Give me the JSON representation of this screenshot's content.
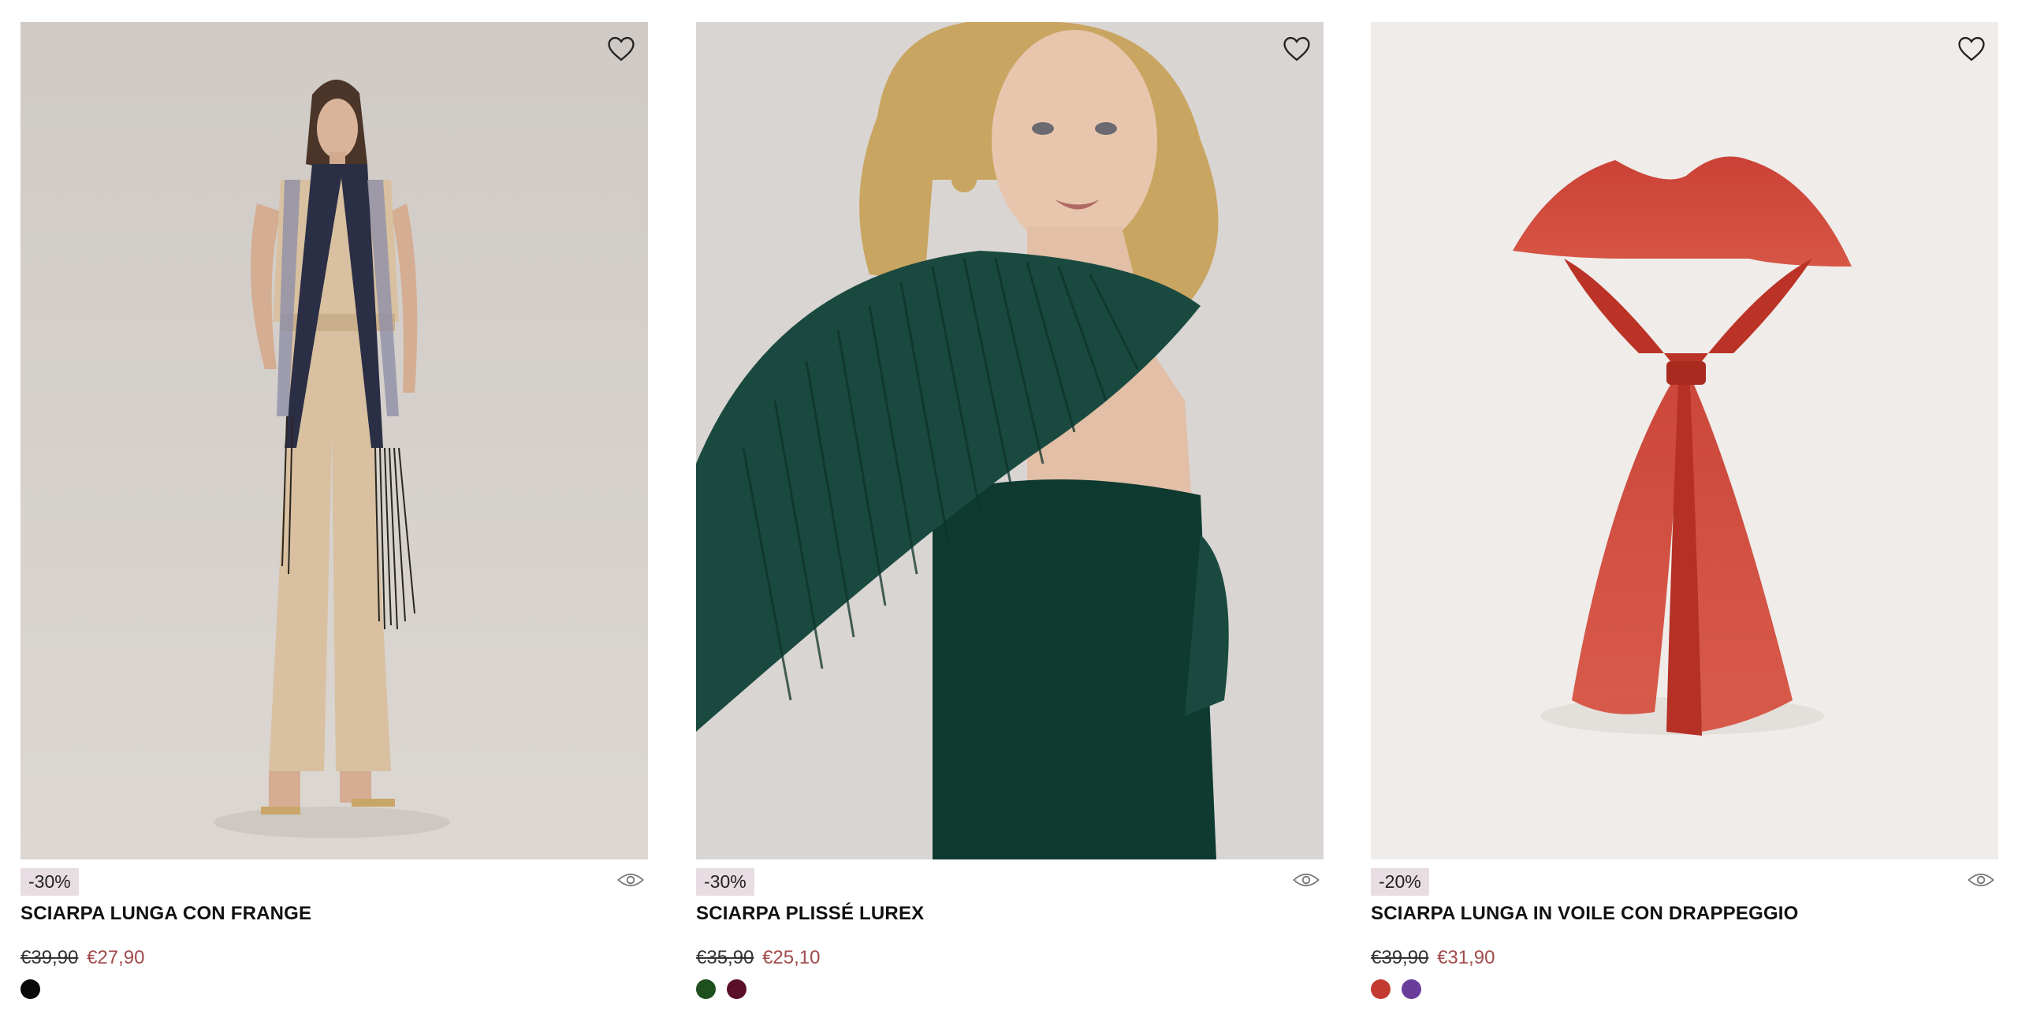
{
  "products": [
    {
      "name": "SCIARPA LUNGA CON FRANGE",
      "discount": "-30%",
      "price_old": "€39,90",
      "price_new": "€27,90",
      "image_description": "model in beige jumpsuit with long fringed scarf",
      "colors": [
        "#0a0a0a"
      ]
    },
    {
      "name": "SCIARPA PLISSÉ LUREX",
      "discount": "-30%",
      "price_old": "€35,90",
      "price_new": "€25,10",
      "image_description": "blonde model wearing dark green plissé scarf",
      "colors": [
        "#1f4f1f",
        "#5a1028"
      ]
    },
    {
      "name": "SCIARPA LUNGA IN VOILE CON DRAPPEGGIO",
      "discount": "-20%",
      "price_old": "€39,90",
      "price_new": "€31,90",
      "image_description": "red voile scarf with drape",
      "colors": [
        "#c23a30",
        "#6a3d9a"
      ]
    }
  ],
  "icons": {
    "wishlist": "heart-icon",
    "quickview": "eye-icon"
  },
  "colors": {
    "badge_bg": "#e8dde2",
    "sale_price": "#a24a4a"
  }
}
